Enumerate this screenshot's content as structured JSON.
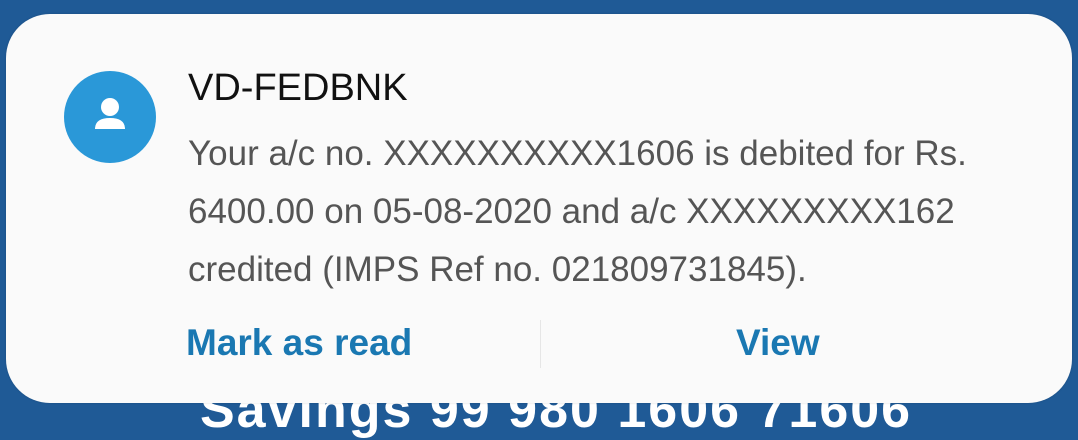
{
  "background_text": "Savings 99 980 1606 71606",
  "notification": {
    "avatar_icon": "person-icon",
    "sender": "VD-FEDBNK",
    "message_lines": [
      "Your a/c no. XXXXXXXXXX1606 is debited for Rs.",
      "6400.00 on 05-08-2020 and a/c XXXXXXXXX162",
      "credited (IMPS Ref no. 021809731845)."
    ],
    "actions": {
      "mark_as_read": "Mark as read",
      "view": "View"
    }
  },
  "colors": {
    "background": "#1f5a96",
    "avatar": "#2a98d8",
    "action_text": "#1a78b2"
  }
}
